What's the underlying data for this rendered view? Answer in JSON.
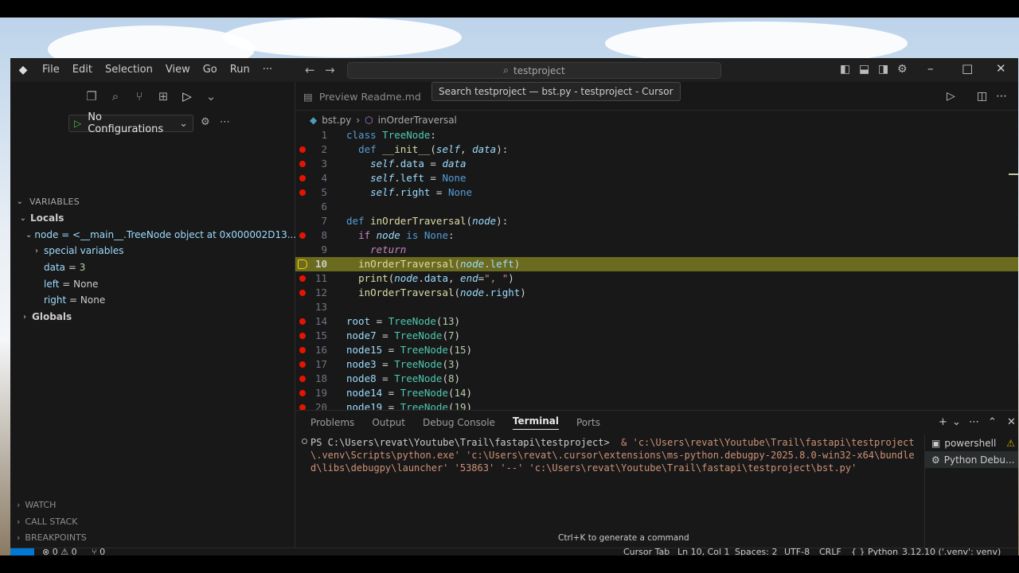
{
  "titlebar": {
    "menu": [
      "File",
      "Edit",
      "Selection",
      "View",
      "Go",
      "Run",
      "···"
    ],
    "search_text": "testproject",
    "tooltip": "Search testproject — bst.py - testproject - Cursor"
  },
  "sidebar": {
    "run_config": "No Configurations",
    "variables_header": "VARIABLES",
    "locals_label": "Locals",
    "node_row": "node = <__main__.TreeNode object at 0x000002D13...",
    "special_vars": "special variables",
    "vars": [
      {
        "name": "data",
        "value": "3"
      },
      {
        "name": "left",
        "value": "None"
      },
      {
        "name": "right",
        "value": "None"
      }
    ],
    "globals_label": "Globals",
    "watch": "WATCH",
    "call_stack": "CALL STACK",
    "breakpoints": "BREAKPOINTS"
  },
  "editor": {
    "preview_tab": "Preview Readme.md",
    "breadcrumb_file": "bst.py",
    "breadcrumb_symbol": "inOrderTraversal",
    "current_line": 10,
    "line_numbers": [
      "1",
      "2",
      "3",
      "4",
      "5",
      "6",
      "7",
      "8",
      "9",
      "10",
      "11",
      "12",
      "13",
      "14",
      "15",
      "16",
      "17",
      "18",
      "19",
      "20"
    ]
  },
  "panel": {
    "tabs": [
      "Problems",
      "Output",
      "Debug Console",
      "Terminal",
      "Ports"
    ],
    "active_tab": "Terminal",
    "prompt": "PS C:\\Users\\revat\\Youtube\\Trail\\fastapi\\testproject>",
    "command": "& 'c:\\Users\\revat\\Youtube\\Trail\\fastapi\\testproject\\.venv\\Scripts\\python.exe' 'c:\\Users\\revat\\.cursor\\extensions\\ms-python.debugpy-2025.8.0-win32-x64\\bundled\\libs\\debugpy\\launcher' '53863' '--' 'c:\\Users\\revat\\Youtube\\Trail\\fastapi\\testproject\\bst.py'",
    "hint": "Ctrl+K to generate a command",
    "terminals": [
      "powershell",
      "Python Debu..."
    ]
  },
  "statusbar": {
    "errors": "0",
    "warnings": "0",
    "ports": "0",
    "cursor_tab": "Cursor Tab",
    "position": "Ln 10, Col 1",
    "spaces": "Spaces: 2",
    "encoding": "UTF-8",
    "eol": "CRLF",
    "language": "Python",
    "interpreter": "3.12.10 ('.venv': venv)"
  },
  "colors": {
    "current_line": "#6b6b1f",
    "breakpoint": "#e51400",
    "accent": "#0078d4"
  }
}
